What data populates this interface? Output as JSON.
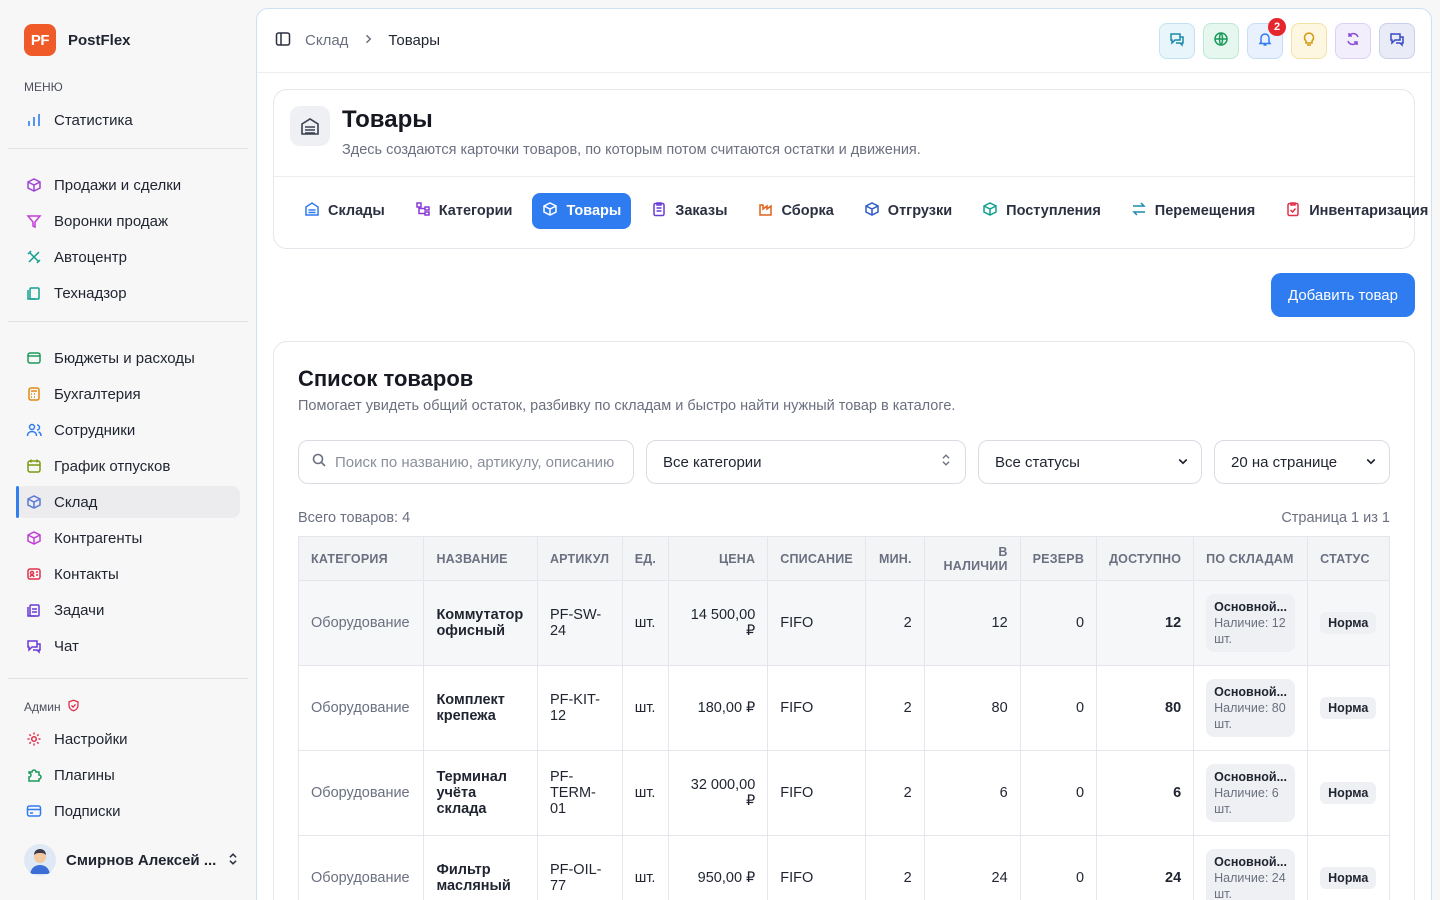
{
  "brand": {
    "logo": "PF",
    "name": "PostFlex"
  },
  "sidebar": {
    "menu_label": "МЕНЮ",
    "group1": [
      {
        "label": "Статистика",
        "icon": "bar-chart-icon"
      }
    ],
    "group2": [
      {
        "label": "Продажи и сделки",
        "icon": "box-icon"
      },
      {
        "label": "Воронки продаж",
        "icon": "funnel-icon"
      },
      {
        "label": "Автоцентр",
        "icon": "wrench-icon"
      },
      {
        "label": "Технадзор",
        "icon": "clipboard-icon"
      }
    ],
    "group3": [
      {
        "label": "Бюджеты и расходы",
        "icon": "wallet-icon"
      },
      {
        "label": "Бухгалтерия",
        "icon": "calculator-icon"
      },
      {
        "label": "Сотрудники",
        "icon": "users-icon"
      },
      {
        "label": "График отпусков",
        "icon": "calendar-icon"
      },
      {
        "label": "Склад",
        "icon": "package-icon"
      },
      {
        "label": "Контрагенты",
        "icon": "cube-icon"
      },
      {
        "label": "Контакты",
        "icon": "contact-card-icon"
      },
      {
        "label": "Задачи",
        "icon": "tasks-icon"
      },
      {
        "label": "Чат",
        "icon": "chat-icon"
      }
    ],
    "admin_label": "Админ",
    "admin": [
      {
        "label": "Настройки",
        "icon": "gear-icon"
      },
      {
        "label": "Плагины",
        "icon": "puzzle-icon"
      },
      {
        "label": "Подписки",
        "icon": "credit-card-icon"
      }
    ],
    "user_name": "Смирнов Алексей ..."
  },
  "topbar": {
    "crumb_parent": "Склад",
    "crumb_current": "Товары",
    "notifications_count": "2"
  },
  "header": {
    "title": "Товары",
    "subtitle": "Здесь создаются карточки товаров, по которым потом считаются остатки и движения.",
    "tabs": [
      "Склады",
      "Категории",
      "Товары",
      "Заказы",
      "Сборка",
      "Отгрузки",
      "Поступления",
      "Перемещения",
      "Инвентаризация"
    ],
    "active_tab": "Товары"
  },
  "add_button": "Добавить товар",
  "list": {
    "title": "Список товаров",
    "subtitle": "Помогает увидеть общий остаток, разбивку по складам и быстро найти нужный товар в каталоге.",
    "search_placeholder": "Поиск по названию, артикулу, описанию",
    "category_filter": "Все категории",
    "status_filter": "Все статусы",
    "page_size": "20 на странице",
    "total": "Всего товаров: 4",
    "pagination": "Страница 1 из 1",
    "columns": [
      "КАТЕГОРИЯ",
      "НАЗВАНИЕ",
      "АРТИКУЛ",
      "ЕД.",
      "ЦЕНА",
      "СПИСАНИЕ",
      "МИН.",
      "В НАЛИЧИИ",
      "РЕЗЕРВ",
      "ДОСТУПНО",
      "ПО СКЛАДАМ",
      "СТАТУС"
    ],
    "rows": [
      {
        "category": "Оборудование",
        "name": "Коммутатор офисный",
        "sku": "PF-SW-24",
        "unit": "шт.",
        "price": "14 500,00 ₽",
        "writeoff": "FIFO",
        "min": "2",
        "in_stock": "12",
        "reserve": "0",
        "available": "12",
        "warehouse": "Основной...",
        "warehouse_qty": "Наличие: 12 шт.",
        "status": "Норма"
      },
      {
        "category": "Оборудование",
        "name": "Комплект крепежа",
        "sku": "PF-KIT-12",
        "unit": "шт.",
        "price": "180,00 ₽",
        "writeoff": "FIFO",
        "min": "2",
        "in_stock": "80",
        "reserve": "0",
        "available": "80",
        "warehouse": "Основной...",
        "warehouse_qty": "Наличие: 80 шт.",
        "status": "Норма"
      },
      {
        "category": "Оборудование",
        "name": "Терминал учёта склада",
        "sku": "PF-TERM-01",
        "unit": "шт.",
        "price": "32 000,00 ₽",
        "writeoff": "FIFO",
        "min": "2",
        "in_stock": "6",
        "reserve": "0",
        "available": "6",
        "warehouse": "Основной...",
        "warehouse_qty": "Наличие: 6 шт.",
        "status": "Норма"
      },
      {
        "category": "Оборудование",
        "name": "Фильтр масляный",
        "sku": "PF-OIL-77",
        "unit": "шт.",
        "price": "950,00 ₽",
        "writeoff": "FIFO",
        "min": "2",
        "in_stock": "24",
        "reserve": "0",
        "available": "24",
        "warehouse": "Основной...",
        "warehouse_qty": "Наличие: 24 шт.",
        "status": "Норма"
      }
    ]
  },
  "colors": {
    "accent": "#2f7bf0",
    "brand": "#f05a28",
    "badge": "#e5262c"
  }
}
